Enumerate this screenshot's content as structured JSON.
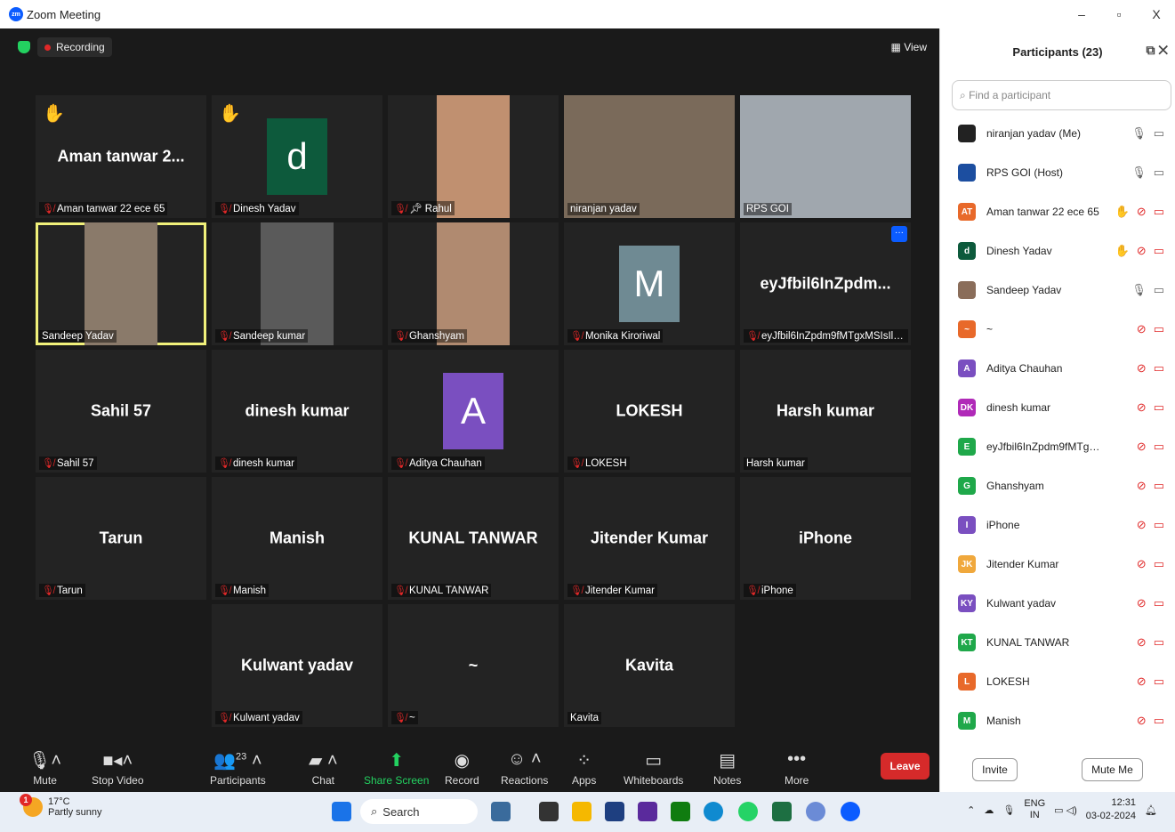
{
  "window": {
    "title": "Zoom Meeting",
    "minimize": "–",
    "restore": "▫",
    "close": "X"
  },
  "stage": {
    "recording": "Recording",
    "view": "View"
  },
  "tiles": [
    {
      "big": "Aman  tanwar 2...",
      "label": "Aman tanwar 22 ece 65",
      "muted": true,
      "hand": true
    },
    {
      "big": "",
      "label": "Dinesh Yadav",
      "muted": true,
      "hand": true,
      "avatar": "d",
      "avatar_color": "#0d5a3c"
    },
    {
      "big": "",
      "label": "Rahul",
      "muted": true,
      "pinned": true,
      "photo": true
    },
    {
      "big": "",
      "label": "niranjan yadav",
      "muted": false,
      "photo": true
    },
    {
      "big": "",
      "label": "RPS GOI",
      "muted": false,
      "photo": true
    },
    {
      "big": "",
      "label": "Sandeep Yadav",
      "muted": false,
      "photo": true,
      "active": true
    },
    {
      "big": "",
      "label": "Sandeep kumar",
      "muted": true,
      "photo": true
    },
    {
      "big": "",
      "label": "Ghanshyam",
      "muted": true,
      "photo": true
    },
    {
      "big": "",
      "label": "Monika Kiroriwal",
      "muted": true,
      "avatar": "M",
      "avatar_color": "#6f8a93"
    },
    {
      "big": "eyJfbil6InZpdm...",
      "label": "eyJfbil6InZpdm9fMTgxMSIsIl9zljoi...",
      "muted": true,
      "more": true
    },
    {
      "big": "Sahil 57",
      "label": "Sahil 57",
      "muted": true
    },
    {
      "big": "dinesh kumar",
      "label": "dinesh kumar",
      "muted": true
    },
    {
      "big": "",
      "label": "Aditya Chauhan",
      "muted": true,
      "avatar": "A",
      "avatar_color": "#7a4fc0"
    },
    {
      "big": "LOKESH",
      "label": "LOKESH",
      "muted": true
    },
    {
      "big": "Harsh kumar",
      "label": "Harsh kumar",
      "muted": false
    },
    {
      "big": "Tarun",
      "label": "Tarun",
      "muted": true
    },
    {
      "big": "Manish",
      "label": "Manish",
      "muted": true
    },
    {
      "big": "KUNAL TANWAR",
      "label": "KUNAL TANWAR",
      "muted": true
    },
    {
      "big": "Jitender Kumar",
      "label": "Jitender Kumar",
      "muted": true
    },
    {
      "big": "iPhone",
      "label": "iPhone",
      "muted": true
    },
    {
      "big": "Kulwant yadav",
      "label": "Kulwant yadav",
      "muted": true
    },
    {
      "big": "~",
      "label": "~",
      "muted": true
    },
    {
      "big": "Kavita",
      "label": "Kavita",
      "muted": false
    }
  ],
  "toolbar": {
    "mute": "Mute",
    "video": "Stop Video",
    "participants": "Participants",
    "participants_count": "23",
    "chat": "Chat",
    "share": "Share Screen",
    "record": "Record",
    "reactions": "Reactions",
    "apps": "Apps",
    "whiteboards": "Whiteboards",
    "notes": "Notes",
    "more": "More",
    "leave": "Leave"
  },
  "panel": {
    "title": "Participants (23)",
    "search_placeholder": "Find a participant",
    "invite": "Invite",
    "mute_me": "Mute Me",
    "participants": [
      {
        "name": "niranjan yadav (Me)",
        "initials": "",
        "color": "#222",
        "mic": "on",
        "video": "off"
      },
      {
        "name": "RPS GOI (Host)",
        "initials": "",
        "color": "#1c4ea0",
        "mic": "on",
        "video": "off"
      },
      {
        "name": "Aman tanwar 22 ece 65",
        "initials": "AT",
        "color": "#e8692a",
        "mic": "off",
        "video": "off",
        "hand": true
      },
      {
        "name": "Dinesh Yadav",
        "initials": "d",
        "color": "#0d5a3c",
        "mic": "off",
        "video": "off",
        "hand": true
      },
      {
        "name": "Sandeep Yadav",
        "initials": "",
        "color": "#8a6d5a",
        "mic": "on",
        "video": "off"
      },
      {
        "name": "~",
        "initials": "~",
        "color": "#e8692a",
        "mic": "off",
        "video": "off"
      },
      {
        "name": "Aditya Chauhan",
        "initials": "A",
        "color": "#7a4fc0",
        "mic": "off",
        "video": "off"
      },
      {
        "name": "dinesh kumar",
        "initials": "DK",
        "color": "#b02ab8",
        "mic": "off",
        "video": "off"
      },
      {
        "name": "eyJfbil6InZpdm9fMTgxMSIsIl9zlj...",
        "initials": "E",
        "color": "#1fa84a",
        "mic": "off",
        "video": "off"
      },
      {
        "name": "Ghanshyam",
        "initials": "G",
        "color": "#1fa84a",
        "mic": "off",
        "video": "off"
      },
      {
        "name": "iPhone",
        "initials": "I",
        "color": "#7a4fc0",
        "mic": "off",
        "video": "off"
      },
      {
        "name": "Jitender Kumar",
        "initials": "JK",
        "color": "#f0a83c",
        "mic": "off",
        "video": "off"
      },
      {
        "name": "Kulwant yadav",
        "initials": "KY",
        "color": "#7a4fc0",
        "mic": "off",
        "video": "off"
      },
      {
        "name": "KUNAL TANWAR",
        "initials": "KT",
        "color": "#1fa84a",
        "mic": "off",
        "video": "off"
      },
      {
        "name": "LOKESH",
        "initials": "L",
        "color": "#e8692a",
        "mic": "off",
        "video": "off"
      },
      {
        "name": "Manish",
        "initials": "M",
        "color": "#1fa84a",
        "mic": "off",
        "video": "off"
      }
    ]
  },
  "taskbar": {
    "temp": "17°C",
    "weather": "Partly sunny",
    "badge": "1",
    "search": "Search",
    "lang1": "ENG",
    "lang2": "IN",
    "time": "12:31",
    "date": "03-02-2024"
  }
}
